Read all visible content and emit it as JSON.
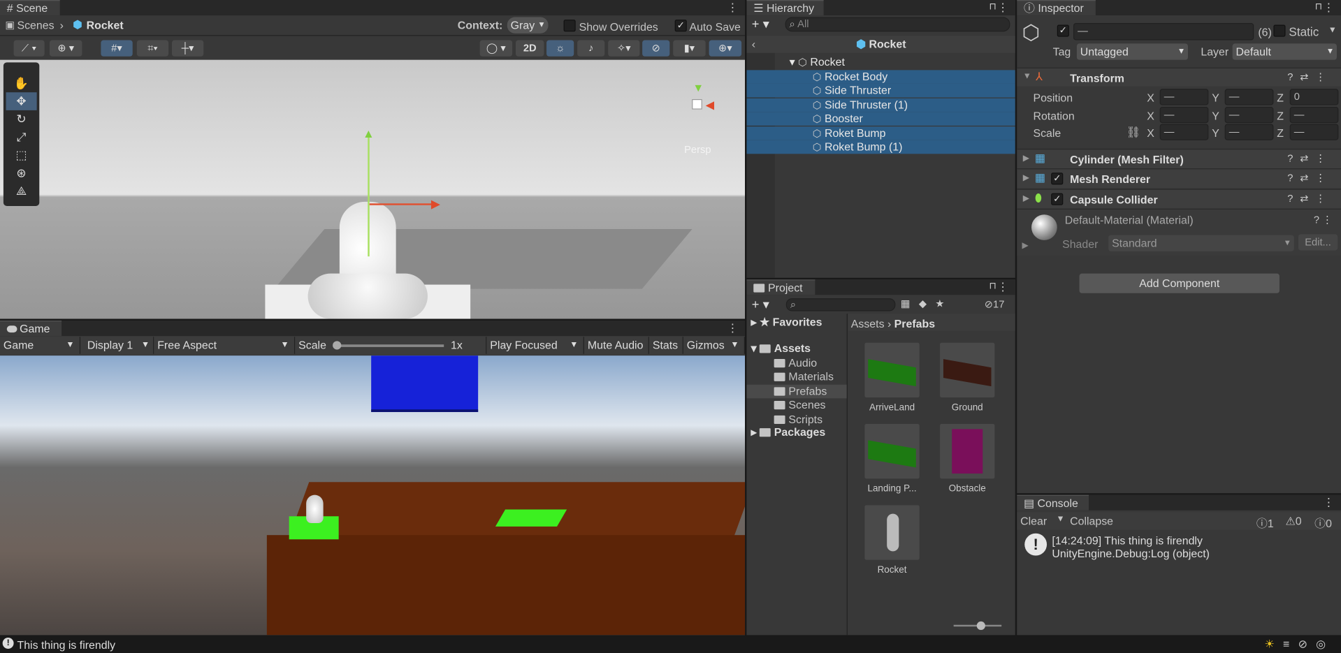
{
  "scene": {
    "tab": "Scene",
    "breadcrumb_root": "Scenes",
    "breadcrumb_current": "Rocket",
    "context_label": "Context:",
    "context_value": "Gray",
    "show_overrides": "Show Overrides",
    "auto_save": "Auto Save",
    "btn_2d": "2D",
    "persp": "Persp"
  },
  "game": {
    "tab": "Game",
    "mode": "Game",
    "display": "Display 1",
    "aspect": "Free Aspect",
    "scale_label": "Scale",
    "scale_value": "1x",
    "play_mode": "Play Focused",
    "mute": "Mute Audio",
    "stats": "Stats",
    "gizmos": "Gizmos"
  },
  "hierarchy": {
    "tab": "Hierarchy",
    "search_placeholder": "All",
    "root": "Rocket",
    "parent": "Rocket",
    "children": [
      "Rocket Body",
      "Side Thruster",
      "Side Thruster (1)",
      "Booster",
      "Roket Bump",
      "Roket Bump (1)"
    ]
  },
  "project": {
    "tab": "Project",
    "favorites": "Favorites",
    "assets": "Assets",
    "folders": [
      "Audio",
      "Materials",
      "Prefabs",
      "Scenes",
      "Scripts"
    ],
    "packages": "Packages",
    "hidden_count": "17",
    "breadcrumb_root": "Assets",
    "breadcrumb_current": "Prefabs",
    "items": [
      {
        "name": "ArriveLand",
        "color": "#1d7a12"
      },
      {
        "name": "Ground",
        "color": "#3a1a12"
      },
      {
        "name": "Landing P...",
        "color": "#1d7a12"
      },
      {
        "name": "Obstacle",
        "color": "#7a0f5a"
      },
      {
        "name": "Rocket",
        "color": "#bbbbbb"
      }
    ]
  },
  "inspector": {
    "tab": "Inspector",
    "name_value": "—",
    "count": "(6)",
    "static": "Static",
    "tag_label": "Tag",
    "tag": "Untagged",
    "layer_label": "Layer",
    "layer": "Default",
    "transform": "Transform",
    "rows": [
      {
        "label": "Position",
        "x": "—",
        "y": "—",
        "z": "0"
      },
      {
        "label": "Rotation",
        "x": "—",
        "y": "—",
        "z": "—"
      },
      {
        "label": "Scale",
        "x": "—",
        "y": "—",
        "z": "—"
      }
    ],
    "axis_x": "X",
    "axis_y": "Y",
    "axis_z": "Z",
    "components": [
      "Cylinder (Mesh Filter)",
      "Mesh Renderer",
      "Capsule Collider"
    ],
    "material": "Default-Material (Material)",
    "shader_label": "Shader",
    "shader": "Standard",
    "edit": "Edit...",
    "add_component": "Add Component"
  },
  "console": {
    "tab": "Console",
    "clear": "Clear",
    "collapse": "Collapse",
    "log_count": "1",
    "warn_count": "0",
    "error_count": "0",
    "message": "[14:24:09] This thing is firendly",
    "message2": "UnityEngine.Debug:Log (object)"
  },
  "status": {
    "message": "This thing is firendly"
  }
}
